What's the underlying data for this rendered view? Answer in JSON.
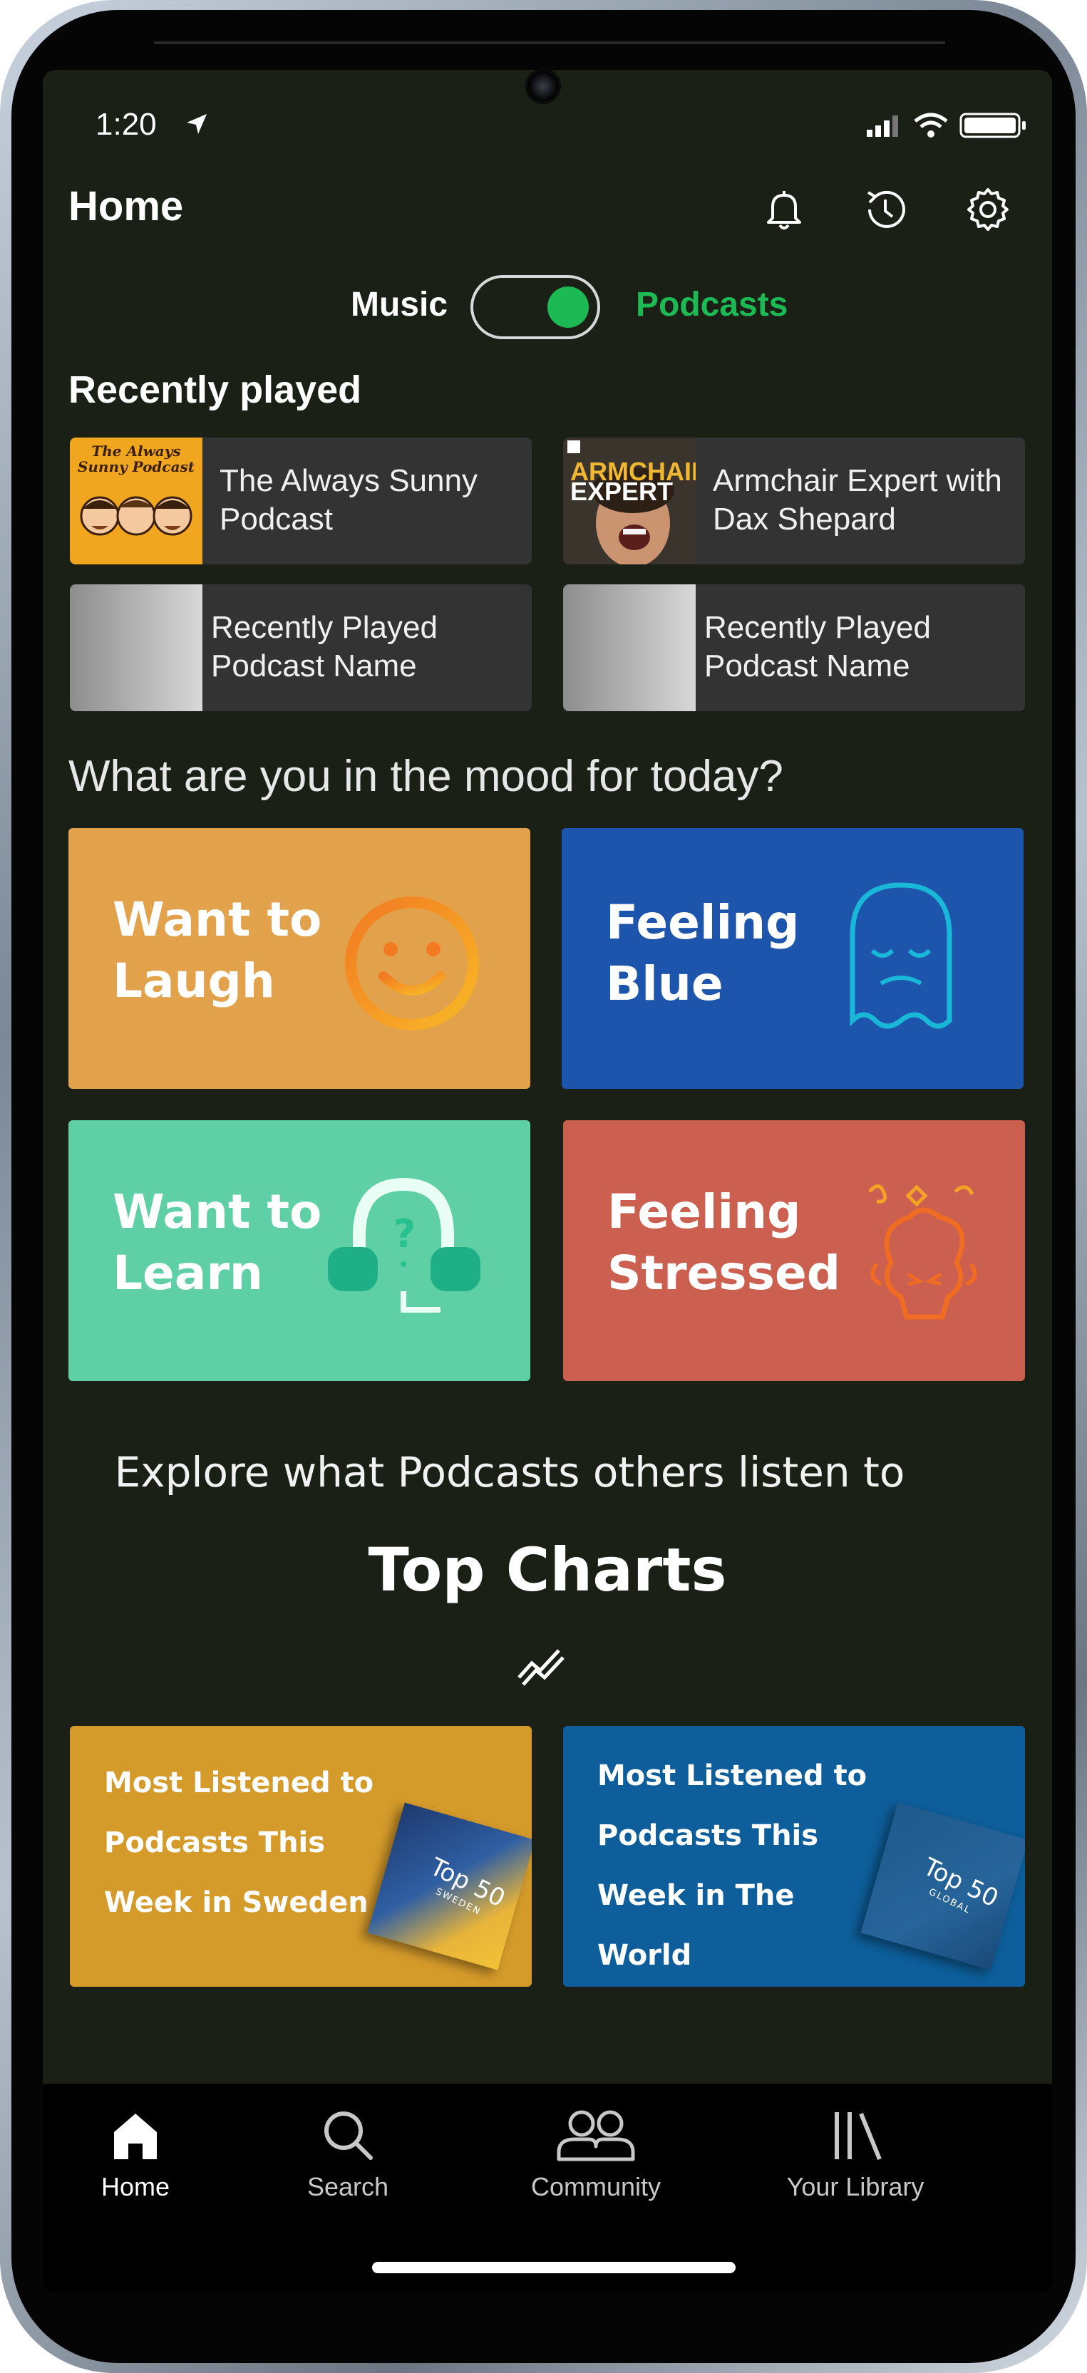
{
  "status": {
    "time": "1:20"
  },
  "header": {
    "title": "Home"
  },
  "toggle": {
    "left_label": "Music",
    "right_label": "Podcasts",
    "state": "Podcasts"
  },
  "recently_played": {
    "heading": "Recently played",
    "items": [
      {
        "label": "The Always Sunny Podcast",
        "art_text": "The Always Sunny Podcast"
      },
      {
        "label": "Armchair Expert with Dax Shepard",
        "art_text": "ARMCHAIR EXPERT"
      },
      {
        "label": "Recently Played Podcast Name"
      },
      {
        "label": "Recently Played Podcast Name"
      }
    ]
  },
  "mood": {
    "heading": "What are you in the mood for today?",
    "cards": [
      {
        "label": "Want to Laugh",
        "color": "#e2a24c",
        "icon": "smiley-face-icon"
      },
      {
        "label": "Feeling Blue",
        "color": "#1e55ac",
        "icon": "sad-ghost-icon"
      },
      {
        "label": "Want to Learn",
        "color": "#5fcfa5",
        "icon": "headset-question-icon"
      },
      {
        "label": "Feeling Stressed",
        "color": "#cb5f50",
        "icon": "stressed-head-icon"
      }
    ]
  },
  "top_charts": {
    "explore_text": "Explore what Podcasts others listen to",
    "title": "Top Charts",
    "cards": [
      {
        "label": "Most Listened to Podcasts This Week in Sweden",
        "color": "#d49a2a",
        "cover_title": "Top 50",
        "cover_sub": "SWEDEN"
      },
      {
        "label": "Most Listened to Podcasts This Week in The World",
        "color": "#0d5e9a",
        "cover_title": "Top 50",
        "cover_sub": "GLOBAL"
      }
    ]
  },
  "nav": {
    "items": [
      {
        "label": "Home",
        "icon": "home-icon",
        "active": true
      },
      {
        "label": "Search",
        "icon": "search-icon",
        "active": false
      },
      {
        "label": "Community",
        "icon": "community-icon",
        "active": false
      },
      {
        "label": "Your Library",
        "icon": "library-icon",
        "active": false
      }
    ]
  },
  "colors": {
    "background": "#1b2016",
    "accent": "#1db954",
    "tile": "#333333"
  }
}
